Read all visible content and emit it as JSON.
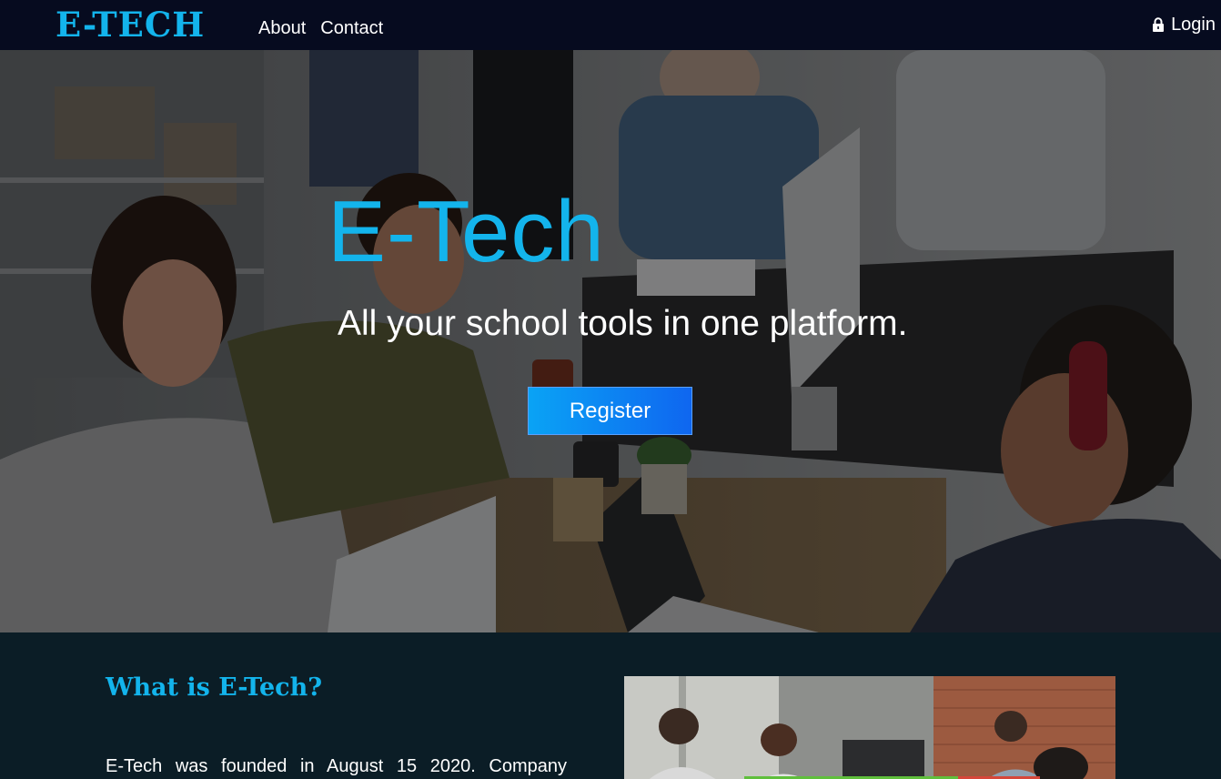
{
  "navbar": {
    "brand": "E-TECH",
    "links": [
      "About",
      "Contact"
    ],
    "login_label": "Login",
    "login_icon": "lock-icon"
  },
  "hero": {
    "title": "E-Tech",
    "subtitle": "All your school tools in one platform.",
    "register_label": "Register"
  },
  "about": {
    "heading": "What is E-Tech?",
    "text": "E-Tech was founded in August 15 2020. Company"
  },
  "colors": {
    "accent": "#13b4ec",
    "nav_bg": "#060b1f",
    "section_bg": "#0b1d26",
    "button_start": "#0aa3f5",
    "button_end": "#0f66f0"
  }
}
